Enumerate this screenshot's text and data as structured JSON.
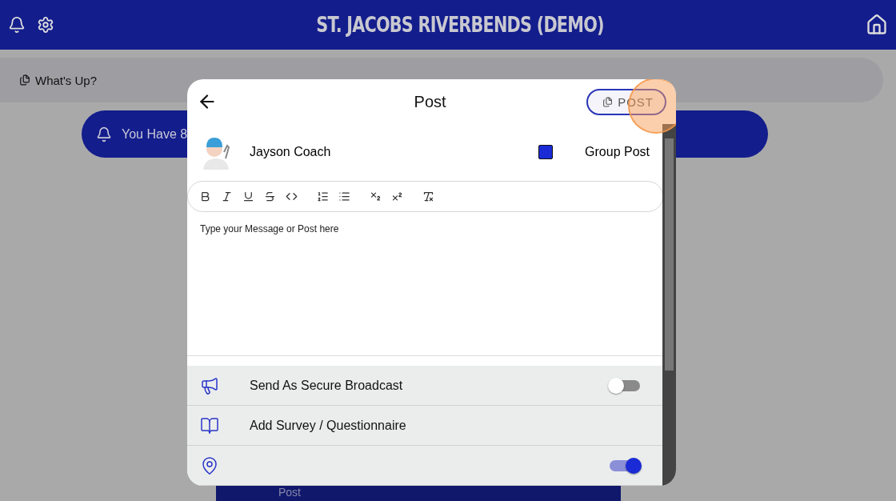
{
  "header": {
    "title": "ST. JACOBS RIVERBENDS (DEMO)"
  },
  "feed": {
    "prompt": "What's Up?",
    "notice": "You Have 8",
    "bottom_label": "Post"
  },
  "modal": {
    "title": "Post",
    "post_button": "POST",
    "author": "Jayson Coach",
    "group_post": {
      "label": "Group Post",
      "checked": true
    },
    "placeholder": "Type your Message or Post here",
    "options": [
      {
        "kind": "toggle",
        "label": "Send As Secure Broadcast",
        "on": false
      },
      {
        "kind": "link",
        "label": "Add Survey / Questionnaire"
      },
      {
        "kind": "toggle",
        "on": true
      }
    ]
  }
}
